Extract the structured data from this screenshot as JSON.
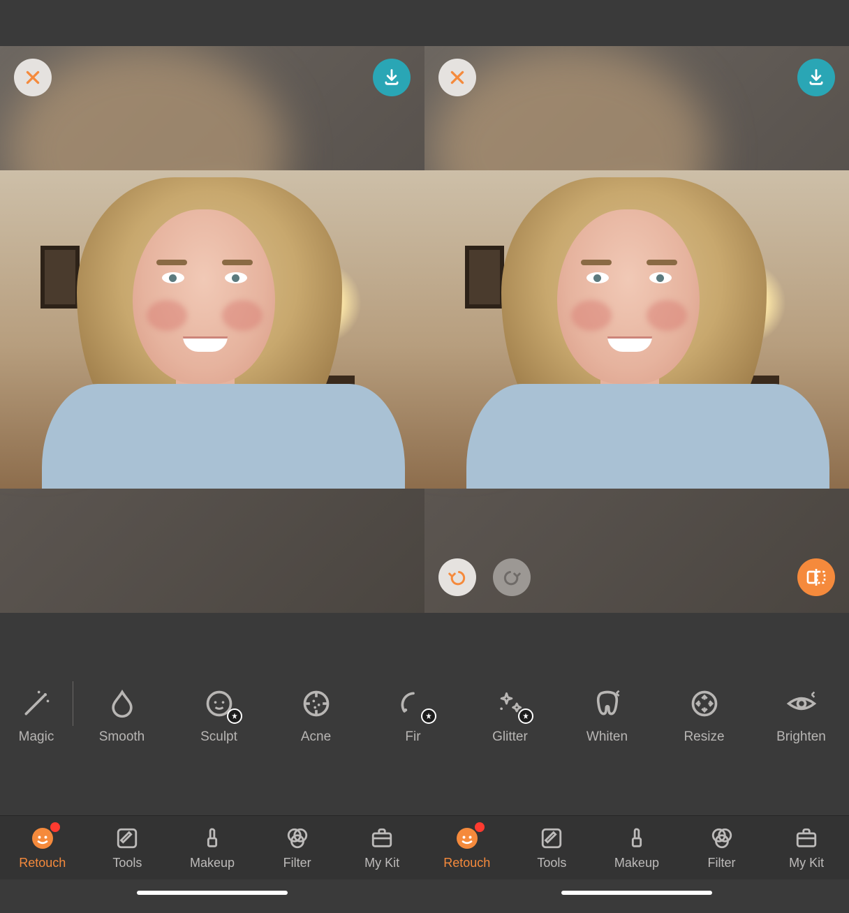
{
  "colors": {
    "accent": "#f58a3c",
    "teal": "#2aa6b5",
    "icon_grey": "#b8b6b4",
    "notify": "#ff3b30"
  },
  "panes": [
    {
      "side": "left",
      "has_undo_redo": false,
      "has_compare": false
    },
    {
      "side": "right",
      "has_undo_redo": true,
      "has_compare": true
    }
  ],
  "tool_strip": [
    {
      "id": "magic",
      "label": "Magic",
      "icon": "wand-icon",
      "premium": false
    },
    {
      "id": "smooth",
      "label": "Smooth",
      "icon": "droplet-icon",
      "premium": false
    },
    {
      "id": "sculpt",
      "label": "Sculpt",
      "icon": "face-mesh-icon",
      "premium": true
    },
    {
      "id": "acne",
      "label": "Acne",
      "icon": "acne-target-icon",
      "premium": false
    },
    {
      "id": "firm",
      "label": "Fir",
      "icon": "firm-arc-icon",
      "premium": true
    },
    {
      "id": "glitter",
      "label": "Glitter",
      "icon": "stars-icon",
      "premium": true
    },
    {
      "id": "whiten",
      "label": "Whiten",
      "icon": "tooth-icon",
      "premium": false
    },
    {
      "id": "resize",
      "label": "Resize",
      "icon": "resize-circle-icon",
      "premium": false
    },
    {
      "id": "brighten",
      "label": "Brighten",
      "icon": "eye-sparkle-icon",
      "premium": false
    }
  ],
  "divider_after_index": 0,
  "bottom_nav": [
    {
      "id": "retouch",
      "label": "Retouch",
      "icon": "retouch-face-icon",
      "active": true,
      "notify": true
    },
    {
      "id": "tools",
      "label": "Tools",
      "icon": "pencil-square-icon",
      "active": false,
      "notify": false
    },
    {
      "id": "makeup",
      "label": "Makeup",
      "icon": "lipstick-icon",
      "active": false,
      "notify": false
    },
    {
      "id": "filter",
      "label": "Filter",
      "icon": "venn-icon",
      "active": false,
      "notify": false
    },
    {
      "id": "mykit",
      "label": "My Kit",
      "icon": "kit-icon",
      "active": false,
      "notify": false
    }
  ],
  "bottom_nav_repeat": 2
}
